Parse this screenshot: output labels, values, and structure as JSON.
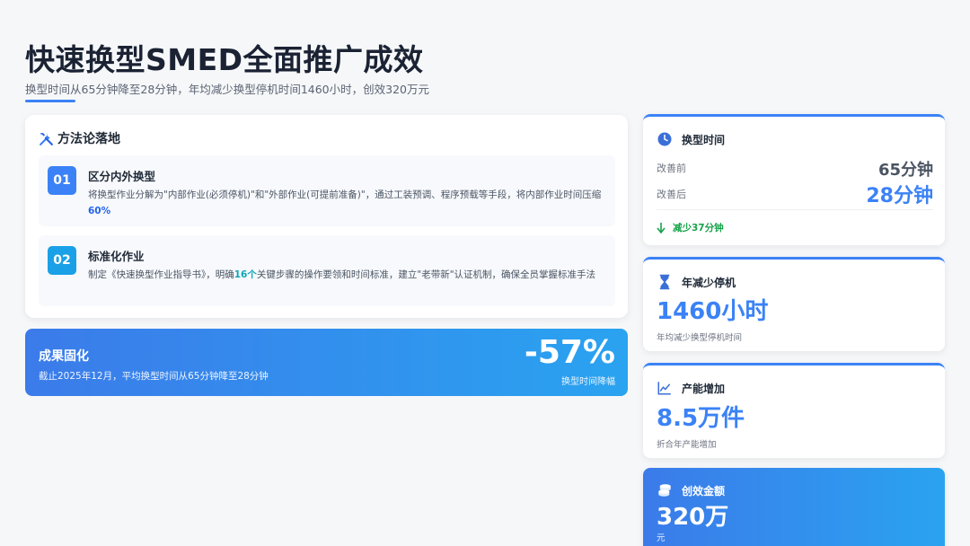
{
  "header": {
    "title": "快速换型SMED全面推广成效",
    "subtitle": "换型时间从65分钟降至28分钟，年均减少换型停机时间1460小时，创效320万元"
  },
  "method": {
    "title": "方法论落地",
    "steps": [
      {
        "num": "01",
        "title": "区分内外换型",
        "desc_a": "将换型作业分解为\"内部作业(必须停机)\"和\"外部作业(可提前准备)\"，通过工装预调、程序预载等手段，将内部作业时间压缩",
        "highlight": "60%",
        "desc_b": ""
      },
      {
        "num": "02",
        "title": "标准化作业",
        "desc_a": "制定《快速换型作业指导书》，明确",
        "highlight": "16个",
        "desc_b": "关键步骤的操作要领和时间标准，建立\"老带新\"认证机制，确保全员掌握标准手法"
      }
    ]
  },
  "result": {
    "title": "成果固化",
    "desc": "截止2025年12月，平均换型时间从65分钟降至28分钟",
    "percent": "-57%",
    "percent_label": "换型时间降幅"
  },
  "cards": {
    "time": {
      "label": "换型时间",
      "before_label": "改善前",
      "before_value": "65分钟",
      "after_label": "改善后",
      "after_value": "28分钟",
      "reduce_text": "减少37分钟"
    },
    "downtime": {
      "label": "年减少停机",
      "value": "1460小时",
      "note": "年均减少换型停机时间"
    },
    "capacity": {
      "label": "产能增加",
      "value": "8.5万件",
      "note": "折合年产能增加"
    },
    "money": {
      "label": "创效金额",
      "value": "320万",
      "note": "元"
    }
  },
  "colors": {
    "accent": "#3b82f6",
    "accent_teal": "#1aa0e6",
    "positive": "#16a34a"
  },
  "icons": [
    "tools-icon",
    "clock-icon",
    "hourglass-icon",
    "chart-line-icon",
    "coins-icon",
    "arrow-down-icon"
  ]
}
